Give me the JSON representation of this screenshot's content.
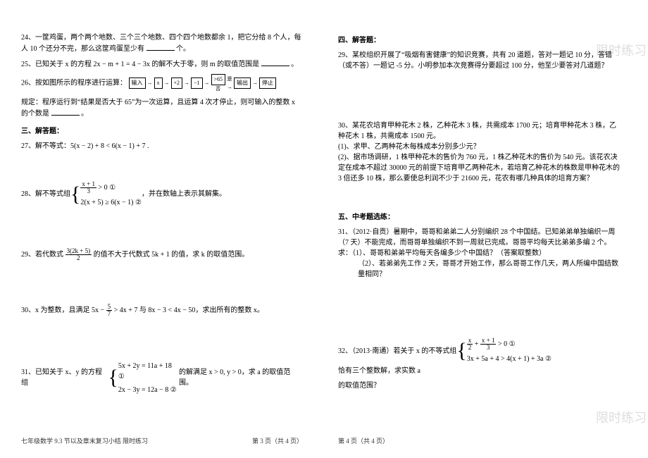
{
  "watermark": "限时练习",
  "left": {
    "q24": "24、一筐鸡蛋，两个两个地数、三个三个地数、四个四个地数都余 1，把它分给 8 个人，每人 10 个还分不完，那么这筐鸡蛋至少有",
    "q24_unit": "个。",
    "q25": "25、已知关于 x 的方程 2x − m + 1 = 4 − 3x  的解不大于零，则 m 的取值范围是",
    "q25_end": "。",
    "q26a": "26、按如图所示的程序进行运算：",
    "flow_in": "输入",
    "flow_x": "x",
    "flow_mul": "×2",
    "flow_sub": "−1",
    "flow_cmp": ">65",
    "flow_yes": "是",
    "flow_no": "否",
    "flow_out": "输出",
    "flow_stop": "停止",
    "q26b": "规定：程序运行到“结果是否大于 65”为一次运算，且运算 4 次才停止，则可输入的整数 x 的个数是",
    "q26_end": "。",
    "sec3": "三、解答题：",
    "q27": "27、解不等式：5(x − 2) + 8 < 6(x − 1) + 7 .",
    "q28a": "28、解不等式组",
    "sys28_1_lhs_num": "x + 1",
    "sys28_1_lhs_den": "3",
    "sys28_1_rest": "> 0        ①",
    "sys28_2": "2(x + 5) ≥ 6(x − 1)  ②",
    "q28b": "，并在数轴上表示其解集。",
    "q29a": "29、若代数式",
    "q29_frac_num": "3(2k + 5)",
    "q29_frac_den": "2",
    "q29b": "的值不大于代数式 5k + 1 的值，求 k 的取值范围。",
    "q30a": "30、x 为整数，且满足 5x −",
    "q30_frac_num": "5",
    "q30_frac_den": "7",
    "q30b": "> 4x + 7 与 8x − 3 < 4x − 50，求出所有的整数 x。",
    "q31a": "31、已知关于 x、y 的方程组",
    "sys31_1": "5x + 2y = 11a + 18 ①",
    "sys31_2": "2x − 3y = 12a − 8   ②",
    "q31b": "的解满足 x > 0, y > 0，求 a 的取值范围。",
    "footer_left": "七年级数学 9.3 节以及章末复习小结  限时练习",
    "footer_right": "第 3 页（共 4 页）"
  },
  "right": {
    "sec4": "四、解答题：",
    "q29r": "29、某校组织开展了“吸烟有害健康”的知识竞赛，共有 20 道题，答对一题记 10 分，答错（或不答）一题记 -5 分。小明参加本次竞赛得分要超过 100 分，他至少要答对几道题？",
    "q30r_a": "30、某花农培育甲种花木 2 株，乙种花木 3 株，共需成本 1700 元；培育甲种花木 3 株，乙种花木 1 株，共需成本 1500 元。",
    "q30r_b": "(1)、求甲、乙两种花木每株成本分别多少元？",
    "q30r_c": "(2)、据市场调研，1 株甲种花木的售价为 760 元，1 株乙种花木的售价为 540 元。该花农决定在成本不超过 30000 元的前提下培育甲乙两种花木，若培育乙种花木的株数是甲种花木的 3 倍还多 10 株，那么要使总利润不少于 21600 元，花农有哪几种具体的培育方案？",
    "sec5": "五、中考题选练：",
    "q31r_a": "31、（2012·自贡）暑期中，哥哥和弟弟二人分别编织 28 个中国结。已知弟弟单独编织一周（7 天）不能完成，而哥哥单独编织不到一周就已完成。哥哥平均每天比弟弟多编 2 个。",
    "q31r_b": "求：（1）、哥哥和弟弟平均每天各编多少个中国结？（答案取整数）",
    "q31r_c": "（2）、若弟弟先工作 2 天，哥哥才开始工作，那么哥哥工作几天，两人所编中国结数量相同？",
    "q32a": "32、（2013·南通）若关于 x 的不等式组",
    "sys32_1a_num1": "x",
    "sys32_1a_den1": "2",
    "sys32_1a_plus": "+",
    "sys32_1a_num2": "x + 1",
    "sys32_1a_den2": "3",
    "sys32_1b": "> 0                   ①",
    "sys32_2": "3x + 5a + 4 > 4(x + 1) + 3a ②",
    "q32b": "恰有三个整数解，求实数 a",
    "q32c": "的取值范围？",
    "footer_left": "第 4 页（共 4 页）"
  }
}
